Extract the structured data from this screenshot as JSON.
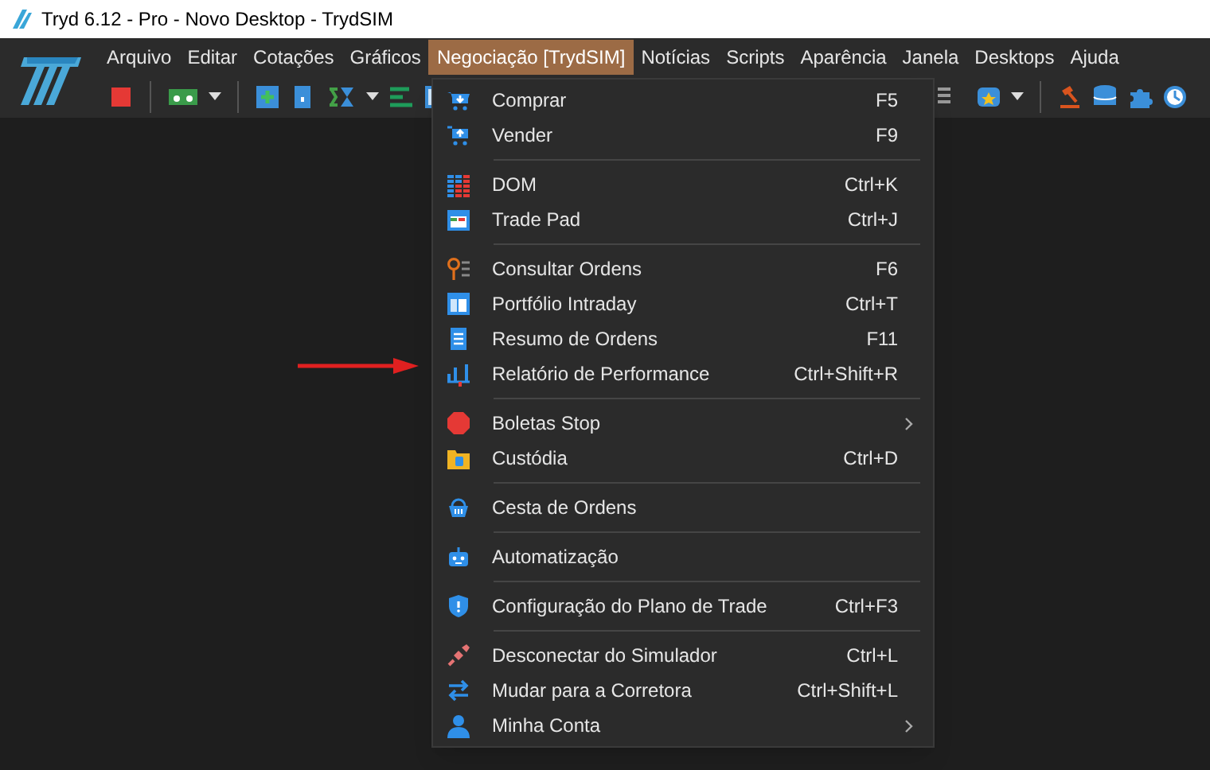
{
  "window": {
    "title": "Tryd 6.12 - Pro - Novo Desktop - TrydSIM"
  },
  "menu_bar": [
    {
      "label": "Arquivo",
      "selected": false
    },
    {
      "label": "Editar",
      "selected": false
    },
    {
      "label": "Cotações",
      "selected": false
    },
    {
      "label": "Gráficos",
      "selected": false
    },
    {
      "label": "Negociação [TrydSIM]",
      "selected": true
    },
    {
      "label": "Notícias",
      "selected": false
    },
    {
      "label": "Scripts",
      "selected": false
    },
    {
      "label": "Aparência",
      "selected": false
    },
    {
      "label": "Janela",
      "selected": false
    },
    {
      "label": "Desktops",
      "selected": false
    },
    {
      "label": "Ajuda",
      "selected": false
    }
  ],
  "dropdown": {
    "sections": [
      [
        {
          "label": "Comprar",
          "shortcut": "F5",
          "submenu": false
        },
        {
          "label": "Vender",
          "shortcut": "F9",
          "submenu": false
        }
      ],
      [
        {
          "label": "DOM",
          "shortcut": "Ctrl+K",
          "submenu": false
        },
        {
          "label": "Trade Pad",
          "shortcut": "Ctrl+J",
          "submenu": false
        }
      ],
      [
        {
          "label": "Consultar Ordens",
          "shortcut": "F6",
          "submenu": false
        },
        {
          "label": "Portfólio Intraday",
          "shortcut": "Ctrl+T",
          "submenu": false
        },
        {
          "label": "Resumo de Ordens",
          "shortcut": "F11",
          "submenu": false
        },
        {
          "label": "Relatório de Performance",
          "shortcut": "Ctrl+Shift+R",
          "submenu": false
        }
      ],
      [
        {
          "label": "Boletas Stop",
          "submenu": true
        },
        {
          "label": "Custódia",
          "shortcut": "Ctrl+D",
          "submenu": false
        }
      ],
      [
        {
          "label": "Cesta de Ordens",
          "submenu": false
        }
      ],
      [
        {
          "label": "Automatização",
          "submenu": false
        }
      ],
      [
        {
          "label": "Configuração do Plano de Trade",
          "shortcut": "Ctrl+F3",
          "submenu": false
        }
      ],
      [
        {
          "label": "Desconectar do Simulador",
          "shortcut": "Ctrl+L",
          "submenu": false
        },
        {
          "label": "Mudar para a Corretora",
          "shortcut": "Ctrl+Shift+L",
          "submenu": false
        },
        {
          "label": "Minha Conta",
          "submenu": true
        }
      ]
    ]
  }
}
